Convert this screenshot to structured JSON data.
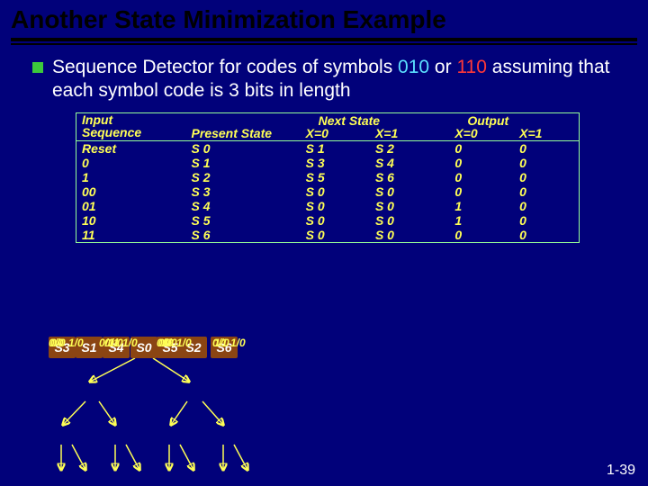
{
  "title": "Another State Minimization Example",
  "bullet": {
    "pre": "Sequence Detector for codes of symbols ",
    "c1": "010",
    "mid": " or ",
    "c2": "110",
    "post": " assuming that each symbol code is 3 bits in length"
  },
  "table": {
    "headers": {
      "input": "Input\nSequence",
      "present": "Present State",
      "nextstate": "Next State",
      "ns_x0": "X=0",
      "ns_x1": "X=1",
      "output": "Output",
      "o_x0": "X=0",
      "o_x1": "X=1"
    },
    "rows": [
      {
        "in": "Reset",
        "ps": "S 0",
        "n0": "S 1",
        "n1": "S 2",
        "o0": "0",
        "o1": "0"
      },
      {
        "in": "0",
        "ps": "S 1",
        "n0": "S 3",
        "n1": "S 4",
        "o0": "0",
        "o1": "0"
      },
      {
        "in": "1",
        "ps": "S 2",
        "n0": "S 5",
        "n1": "S 6",
        "o0": "0",
        "o1": "0"
      },
      {
        "in": "00",
        "ps": "S 3",
        "n0": "S 0",
        "n1": "S 0",
        "o0": "0",
        "o1": "0"
      },
      {
        "in": "01",
        "ps": "S 4",
        "n0": "S 0",
        "n1": "S 0",
        "o0": "1",
        "o1": "0"
      },
      {
        "in": "10",
        "ps": "S 5",
        "n0": "S 0",
        "n1": "S 0",
        "o0": "1",
        "o1": "0"
      },
      {
        "in": "11",
        "ps": "S 6",
        "n0": "S 0",
        "n1": "S 0",
        "o0": "0",
        "o1": "0"
      }
    ]
  },
  "diagram": {
    "n0": "S0",
    "n1": "S1",
    "n2": "S2",
    "n3": "S3",
    "n4": "S4",
    "n5": "S5",
    "n6": "S6",
    "e_s0_s1": "0/0",
    "e_s0_s2": "1/0",
    "e_s1_s3": "0/0",
    "e_s1_s4": "1/0",
    "e_s2_s5": "0/0",
    "e_s2_s6": "1/0",
    "e_s3_a": "1/0",
    "e_s3_b": "0/0",
    "e_s4_a": "1/0",
    "e_s4_b": "0/1",
    "e_s5_a": "1/0",
    "e_s5_b": "0/0",
    "e_s6_a": "1/0",
    "e_s6_b": "0/1"
  },
  "pagenum": "1-39"
}
